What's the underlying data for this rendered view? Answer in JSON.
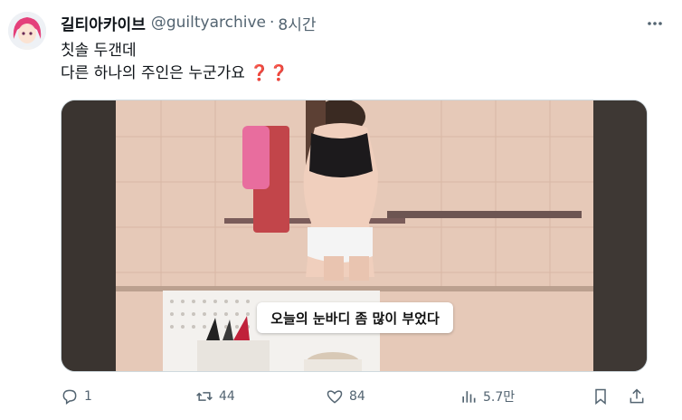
{
  "author": {
    "display_name": "길티아카이브",
    "handle": "@guiltyarchive",
    "separator": "·",
    "time": "8시간"
  },
  "tweet": {
    "line1": "칫솔 두갠데",
    "line2": "다른 하나의 주인은 누군가요",
    "line2_emoji": "❓❓"
  },
  "media": {
    "caption": "오늘의 눈바디 좀 많이 부었다"
  },
  "actions": {
    "replies": "1",
    "retweets": "44",
    "likes": "84",
    "views": "5.7만"
  },
  "colors": {
    "accent_question": "#c01c28",
    "secondary_text": "#536471"
  }
}
